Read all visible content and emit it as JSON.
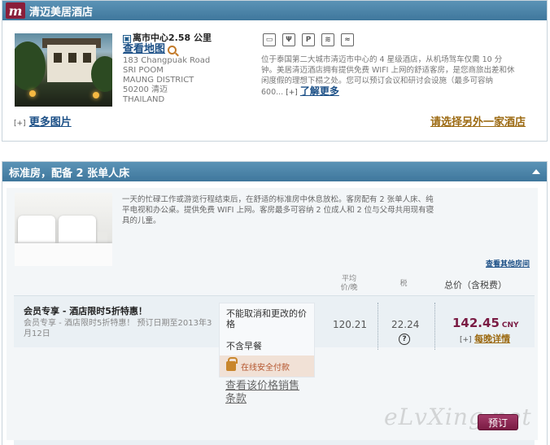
{
  "hotel": {
    "logo_letter": "m",
    "name": "清迈美居酒店",
    "distance": "离市中心2.58 公里",
    "distance_icon": "city-center-icon",
    "map_link": "查看地图",
    "address": [
      "183 Changpuak Road",
      "SRI POOM",
      "MAUNG DISTRICT",
      "50200 清迈",
      "THAILAND"
    ],
    "amenity_icons": [
      {
        "name": "tv-icon",
        "glyph": "▭"
      },
      {
        "name": "restaurant-icon",
        "glyph": "Ψ"
      },
      {
        "name": "parking-icon",
        "glyph": "P"
      },
      {
        "name": "wifi-icon",
        "glyph": "≋"
      },
      {
        "name": "pool-icon",
        "glyph": "≈"
      }
    ],
    "description": "位于泰国第二大城市清迈市中心的 4 星级酒店，从机场驾车仅需 10 分钟。美居清迈酒店拥有提供免费 WIFI 上网的舒适客房，是您商旅出差和休闲度假的理想下榻之处。您可以预订会议和研讨会设施（最多可容纳 600...",
    "more_plus": "[+]",
    "more_label": "了解更多",
    "more_photos_plus": "[+]",
    "more_photos_label": "更多图片",
    "other_hotel": "请选择另外一家酒店"
  },
  "room": {
    "title": "标准房，配备 2 张单人床",
    "description": "一天的忙碌工作或游览行程结束后，在舒适的标准房中休息放松。客房配有 2 张单人床、纯平电视和办公桌。提供免费 WIFI 上网。客房最多可容纳 2 位成人和 2 位与父母共用现有寝具的儿童。",
    "other_rooms": "查看其他房间",
    "columns": {
      "avg_line1": "平均",
      "avg_line2": "价/晚",
      "tax": "税",
      "total": "总价（含税费）"
    },
    "rate": {
      "title": "会员专享 - 酒店限时5折特惠！",
      "subtitle": "会员专享 - 酒店限时5折特惠！ 预订日期至2013年3月12日",
      "policy_cancel": "不能取消和更改的价格",
      "policy_breakfast": "不含早餐",
      "secure_payment": "在线安全付款",
      "terms": "查看该价格销售条款",
      "avg_price": "120.21",
      "tax": "22.24",
      "total": "142.45",
      "currency": "CNY",
      "nightly_plus": "[+]",
      "nightly_label": "每晚详情",
      "book": "预订"
    }
  },
  "watermark": "eLvXing.net"
}
